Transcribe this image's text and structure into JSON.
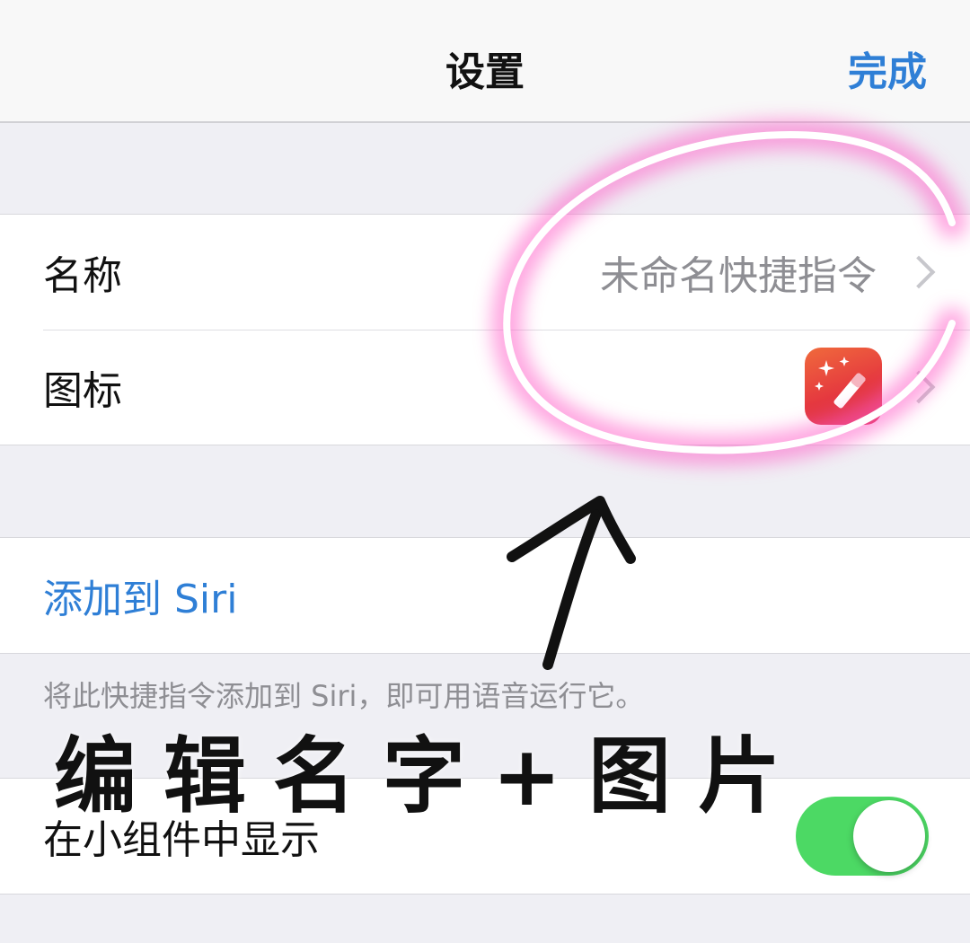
{
  "navbar": {
    "title": "设置",
    "done_label": "完成"
  },
  "details": {
    "name_label": "名称",
    "name_value": "未命名快捷指令",
    "icon_label": "图标",
    "icon_name": "magic-wand-icon",
    "icon_colors": [
      "#f06a3c",
      "#d92c4c"
    ]
  },
  "siri": {
    "add_label": "添加到 Siri",
    "footnote": "将此快捷指令添加到 Siri，即可用语音运行它。"
  },
  "widget": {
    "show_label": "在小组件中显示",
    "toggle_on": true,
    "toggle_color": "#4cd964"
  },
  "annotation": {
    "caption": "编辑名字+图片",
    "circle_color": "#ff5fc8"
  },
  "colors": {
    "accent": "#2f7fd6",
    "secondary_text": "#8e8e93"
  }
}
